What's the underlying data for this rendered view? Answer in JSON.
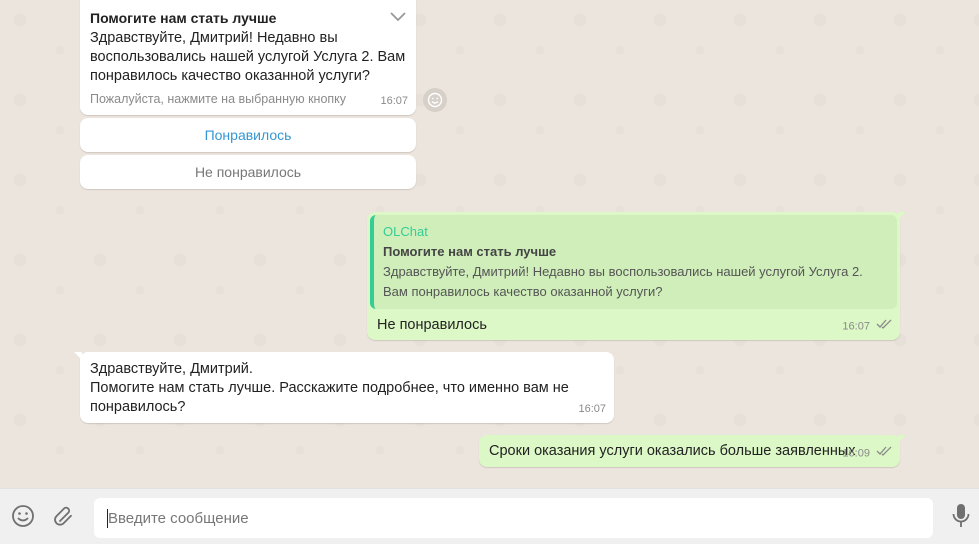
{
  "messages": {
    "survey": {
      "title": "Помогите нам стать лучше",
      "body": "Здравствуйте, Дмитрий! Недавно вы воспользовались нашей услугой Услуга 2. Вам понравилось качество оказанной услуги?",
      "hint": "Пожалуйста, нажмите на выбранную кнопку",
      "time": "16:07",
      "buttons": [
        "Понравилось",
        "Не понравилось"
      ]
    },
    "reply": {
      "quote_sender": "OLChat",
      "quote_title": "Помогите нам стать лучше",
      "quote_text": "Здравствуйте, Дмитрий! Недавно вы воспользовались нашей услугой Услуга 2. Вам понравилось качество оказанной услуги?",
      "text": "Не понравилось",
      "time": "16:07"
    },
    "incoming_2": {
      "line1": "Здравствуйте, Дмитрий.",
      "line2": "Помогите нам стать лучше. Расскажите подробнее, что именно вам не понравилось?",
      "time": "16:07"
    },
    "outgoing_2": {
      "text": "Сроки оказания услуги оказались больше заявленных",
      "time": "16:09"
    }
  },
  "composer": {
    "placeholder": "Введите сообщение",
    "value": ""
  },
  "icons": {
    "emoji": "emoji-icon",
    "attach": "paperclip-icon",
    "mic": "microphone-icon",
    "react": "smiley-icon",
    "read": "double-check-icon",
    "menu": "chevron-down-icon"
  },
  "colors": {
    "incoming_bg": "#ffffff",
    "outgoing_bg": "#dcf8c6",
    "quote_accent": "#35cd96",
    "button_link": "#3497d3"
  }
}
